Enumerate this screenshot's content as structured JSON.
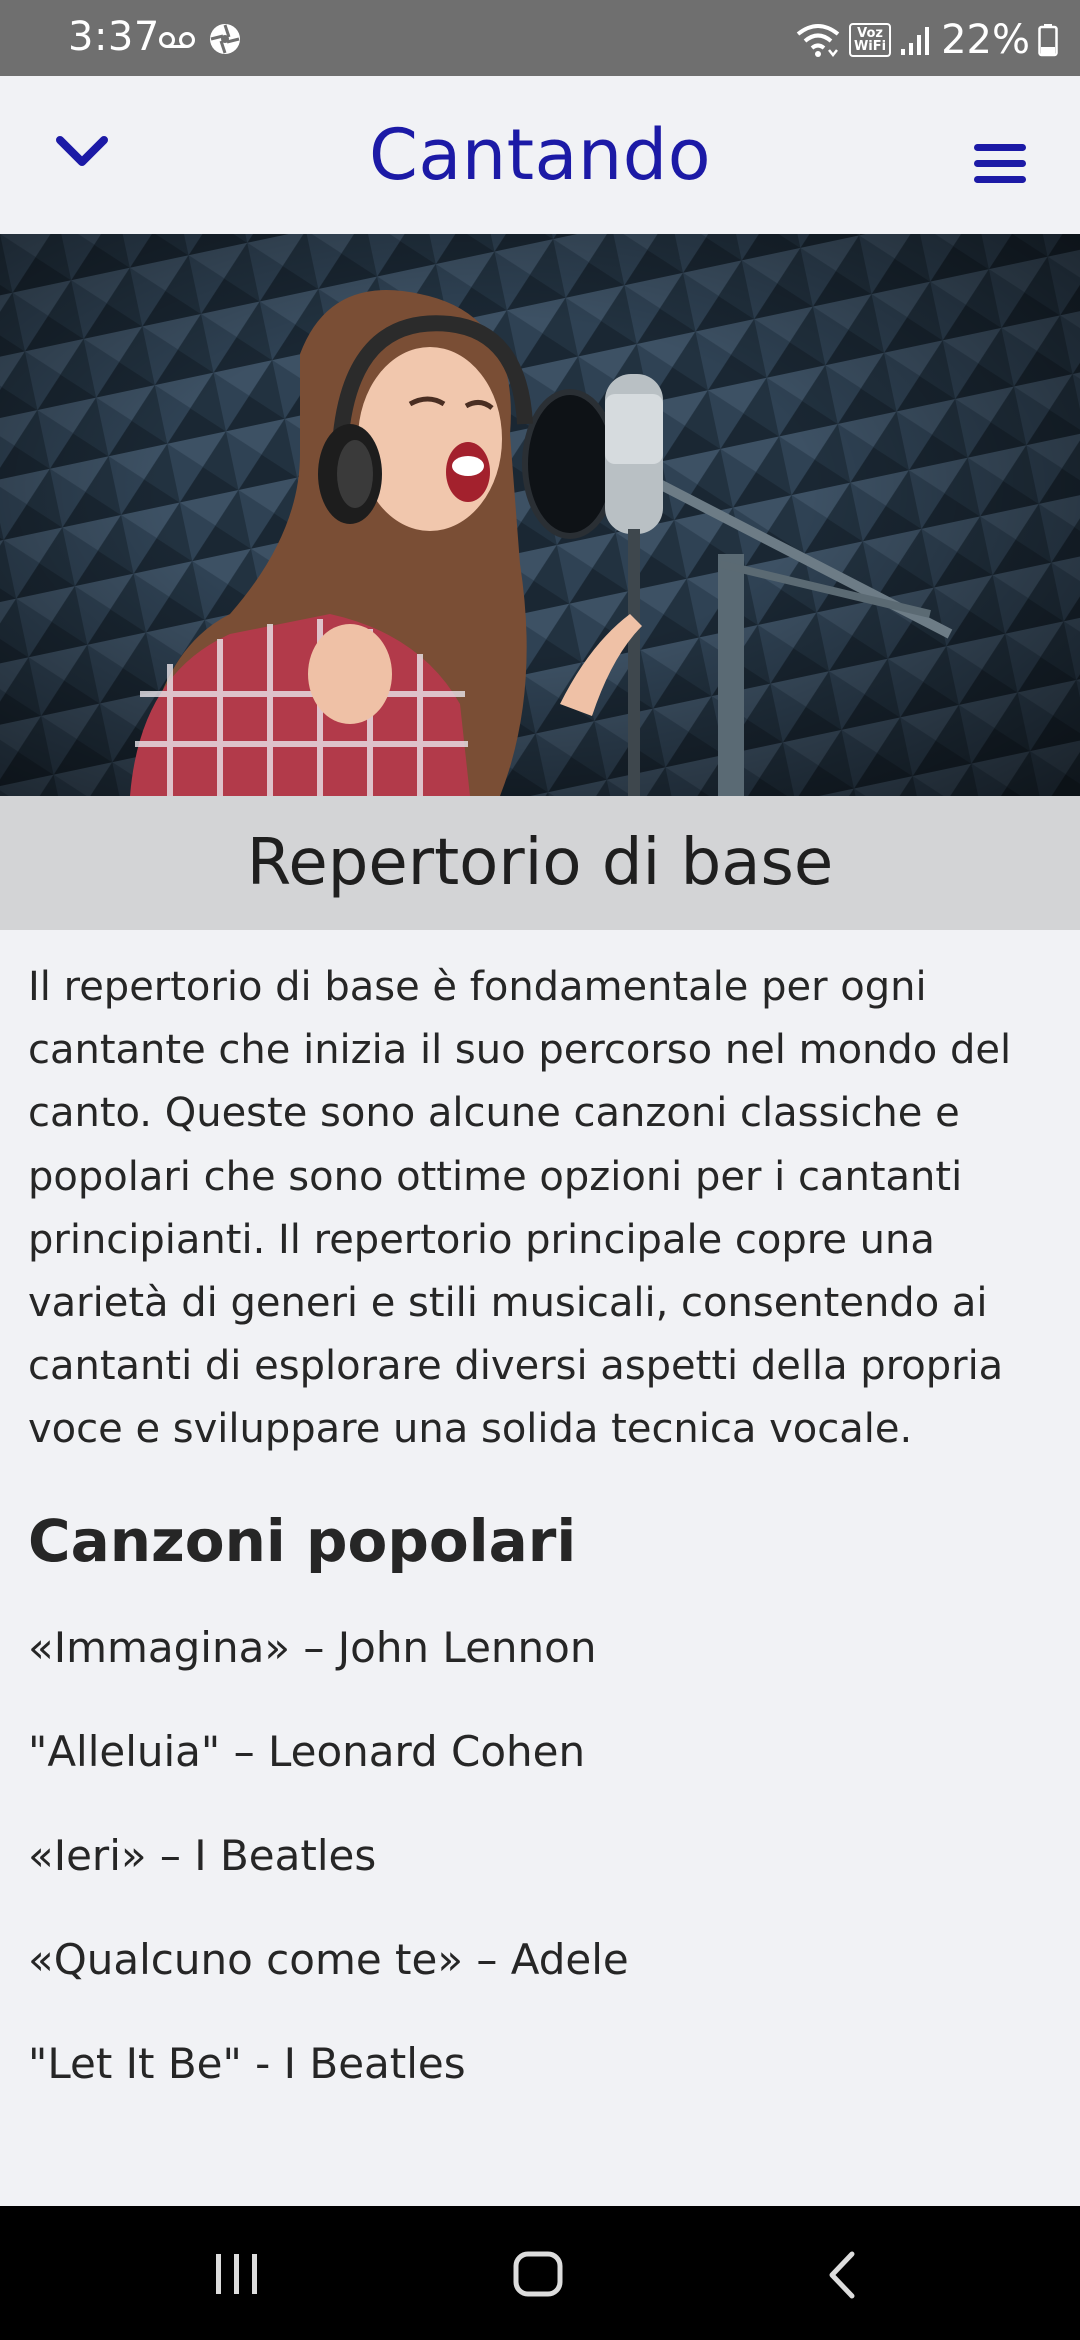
{
  "status_bar": {
    "time": "3:37",
    "battery": "22%",
    "wifi_label_top": "Voz",
    "wifi_label_bottom": "WiFi"
  },
  "header": {
    "title": "Cantando",
    "collapse_icon": "chevron-down-icon",
    "menu_icon": "hamburger-menu-icon"
  },
  "hero": {
    "subject": "singer-in-recording-studio-image"
  },
  "section": {
    "title": "Repertorio di base"
  },
  "intro": "Il repertorio di base è fondamentale per ogni cantante che inizia il suo percorso nel mondo del canto. Queste sono alcune canzoni classiche e popolari che sono ottime opzioni per i cantanti principianti. Il repertorio principale copre una varietà di generi e stili musicali, consentendo ai cantanti di esplorare diversi aspetti della propria voce e sviluppare una solida tecnica vocale.",
  "songs": {
    "title": "Canzoni popolari",
    "items": [
      "«Immagina» – John Lennon",
      "\"Alleluia\" – Leonard Cohen",
      "«Ieri» – I Beatles",
      "«Qualcuno come te» – Adele",
      "\"Let It Be\" - I Beatles"
    ]
  },
  "colors": {
    "brand": "#1c1aa6",
    "band": "#d3d4d6",
    "background": "#f1f2f5"
  }
}
